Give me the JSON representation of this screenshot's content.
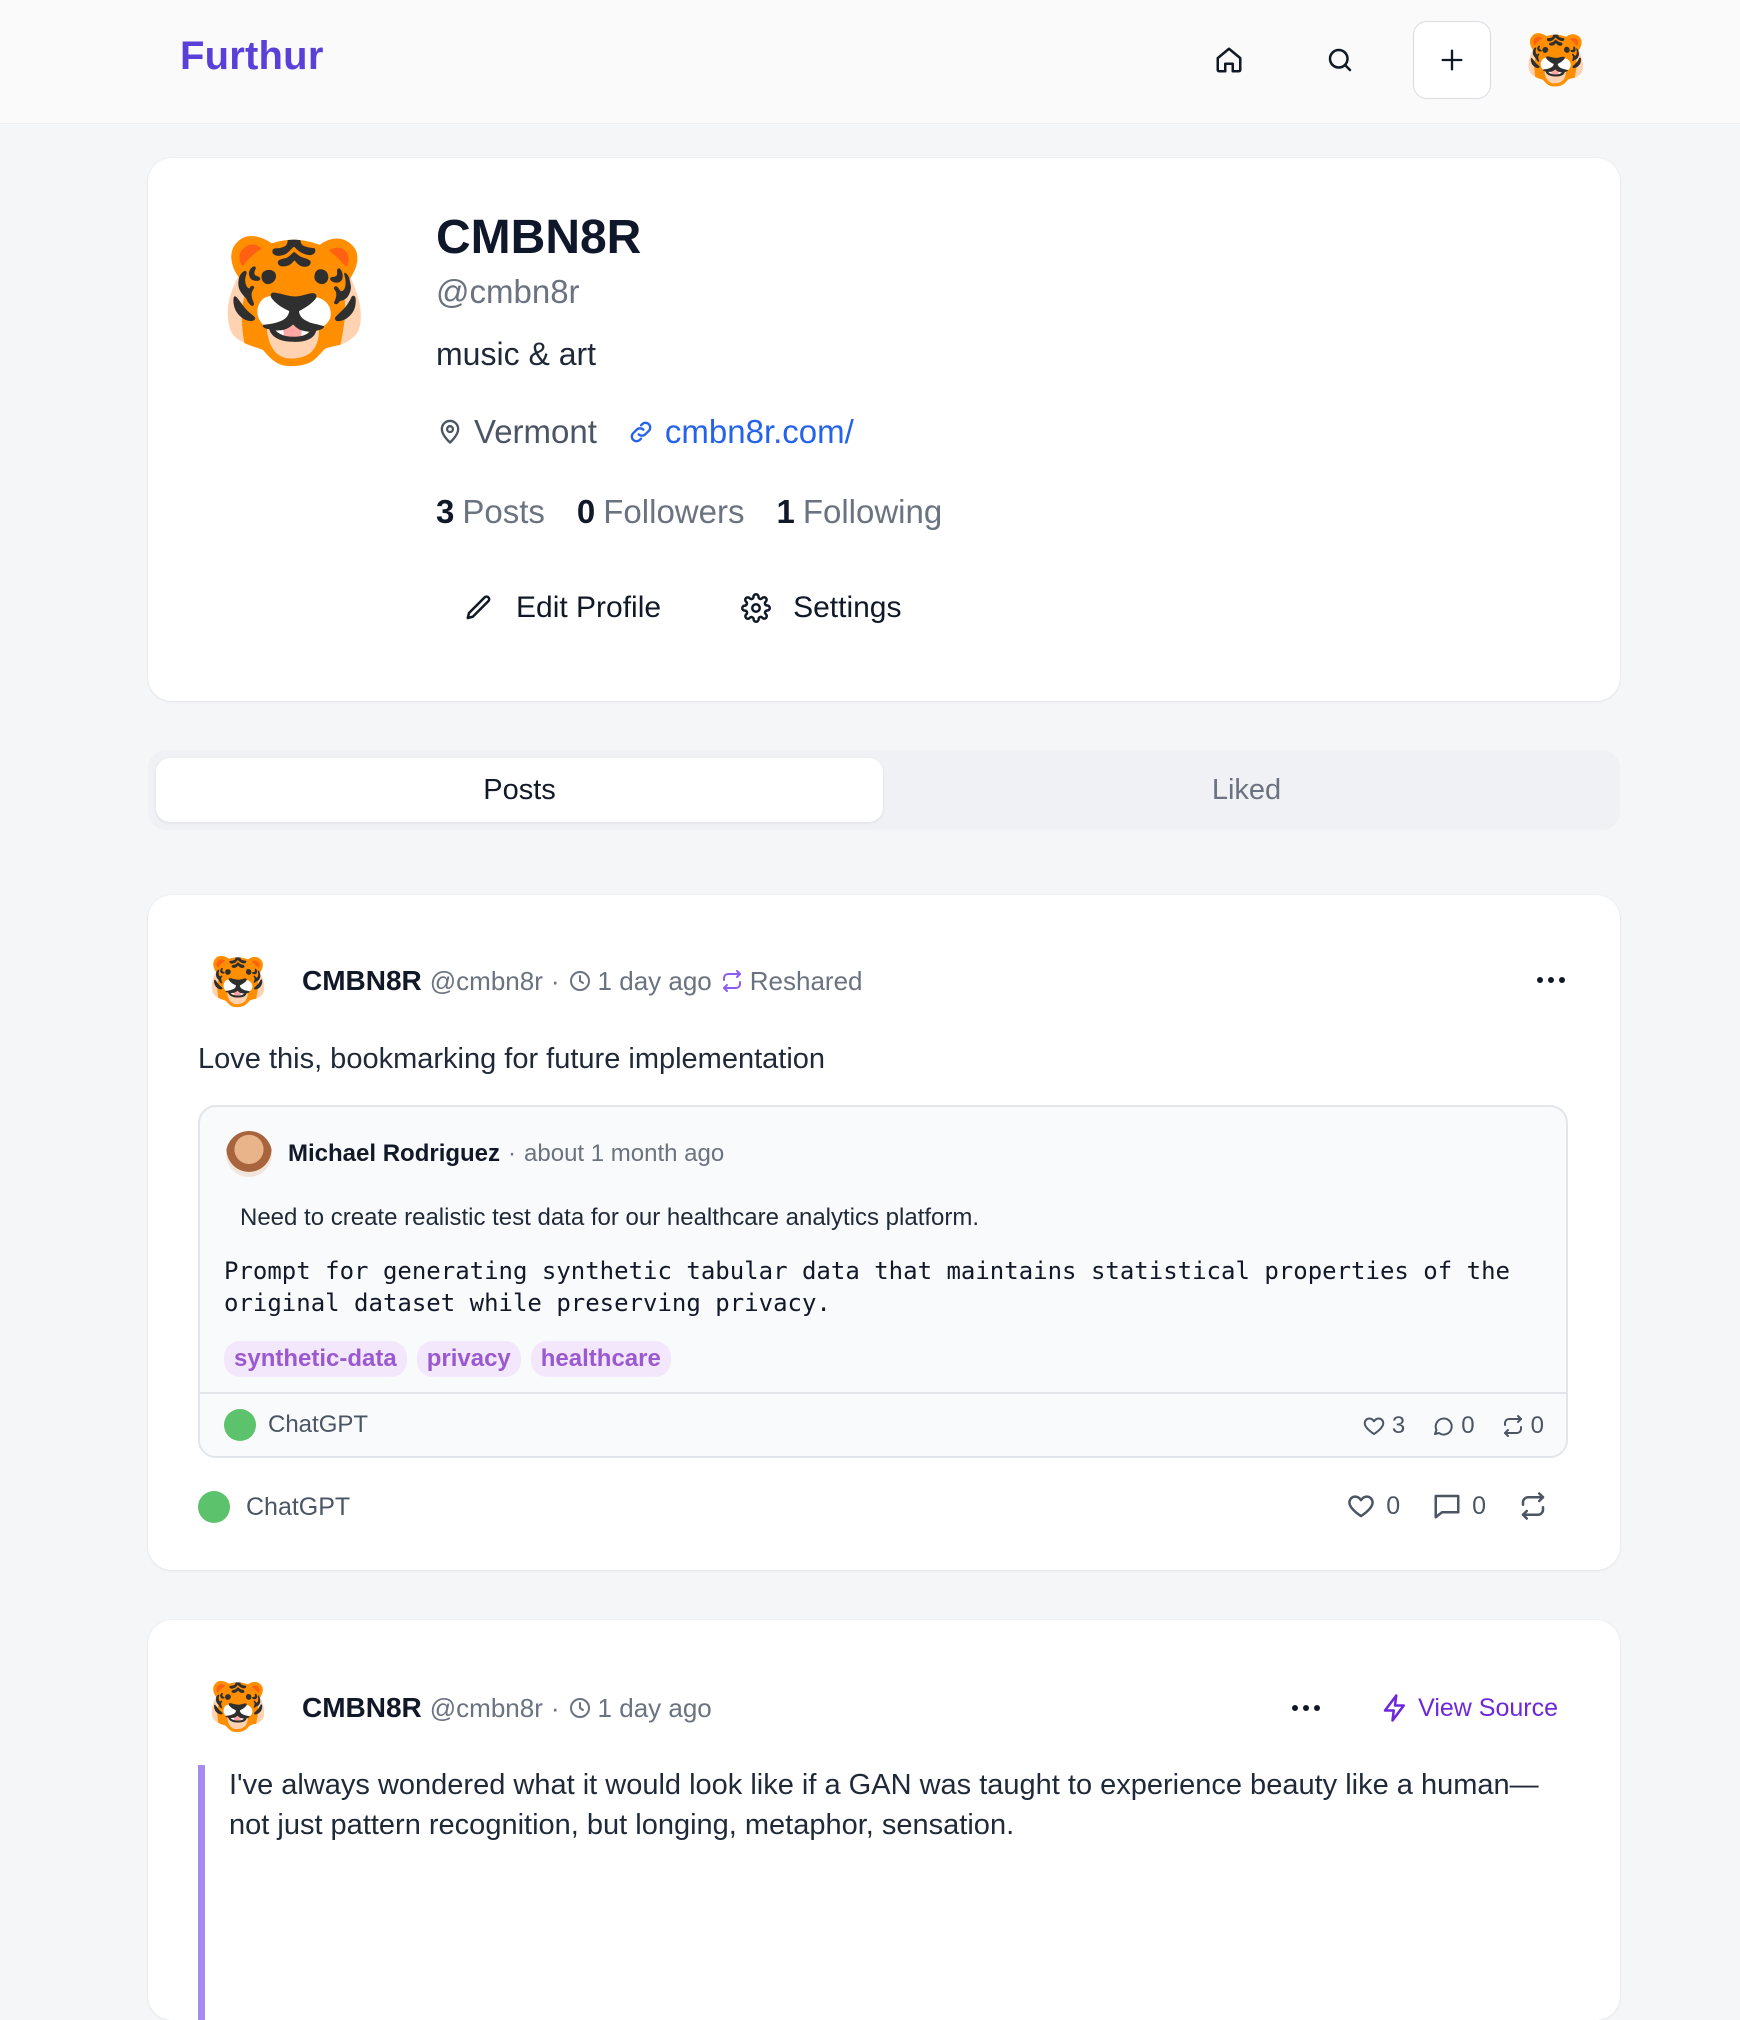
{
  "app": {
    "logo": "Furthur",
    "current_user_avatar": "🐯"
  },
  "profile": {
    "avatar": "🐯",
    "name": "CMBN8R",
    "handle": "@cmbn8r",
    "bio": "music & art",
    "location": "Vermont",
    "website": "cmbn8r.com/",
    "stats": {
      "posts_count": "3",
      "posts_label": "Posts",
      "followers_count": "0",
      "followers_label": "Followers",
      "following_count": "1",
      "following_label": "Following"
    },
    "edit_label": "Edit Profile",
    "settings_label": "Settings"
  },
  "tabs": [
    {
      "label": "Posts",
      "active": true
    },
    {
      "label": "Liked",
      "active": false
    }
  ],
  "posts": [
    {
      "avatar": "🐯",
      "author": "CMBN8R",
      "handle": "@cmbn8r",
      "sep": "·",
      "time": "1 day ago",
      "reshared_label": "Reshared",
      "text": "Love this, bookmarking for future implementation",
      "quoted": {
        "author": "Michael Rodriguez",
        "sep": "·",
        "time": "about 1 month ago",
        "description": "Need to create realistic test data for our healthcare analytics platform.",
        "prompt": "Prompt for generating synthetic tabular data that maintains statistical properties of the original dataset while preserving privacy.",
        "tags": [
          "synthetic-data",
          "privacy",
          "healthcare"
        ],
        "model": "ChatGPT",
        "likes": "3",
        "comments": "0",
        "reshares": "0"
      },
      "model": "ChatGPT",
      "likes": "0",
      "comments": "0"
    },
    {
      "avatar": "🐯",
      "author": "CMBN8R",
      "handle": "@cmbn8r",
      "sep": "·",
      "time": "1 day ago",
      "view_source_label": "View Source",
      "text": "I've always wondered what it would look like if a GAN was taught to experience beauty like a human—not just pattern recognition, but longing, metaphor, sensation."
    }
  ],
  "colors": {
    "brand": "#5b3fd9",
    "link": "#2563eb",
    "model_dot": "#5cc26b",
    "tag_text": "#9b59d0",
    "tag_bg": "#f3e8fb",
    "quote_bar": "#a68bf0"
  },
  "icons": [
    "home-icon",
    "search-icon",
    "plus-icon",
    "map-pin-icon",
    "link-icon",
    "pencil-icon",
    "gear-icon",
    "clock-icon",
    "reshare-icon",
    "more-icon",
    "heart-icon",
    "comment-icon",
    "lightning-icon"
  ]
}
